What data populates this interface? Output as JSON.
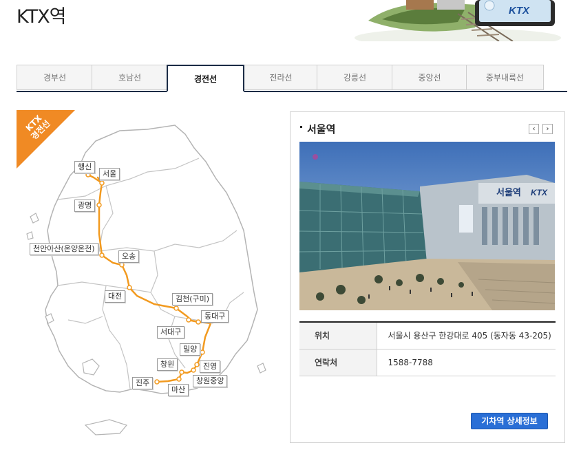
{
  "page": {
    "title": "KTX역"
  },
  "banner": {
    "logo_text": "KTX"
  },
  "tabs": [
    {
      "label": "경부선",
      "active": false
    },
    {
      "label": "호남선",
      "active": false
    },
    {
      "label": "경전선",
      "active": true
    },
    {
      "label": "전라선",
      "active": false
    },
    {
      "label": "강릉선",
      "active": false
    },
    {
      "label": "중앙선",
      "active": false
    },
    {
      "label": "중부내륙선",
      "active": false
    }
  ],
  "map": {
    "ribbon_line1": "KTX",
    "ribbon_line2": "경전선",
    "line_color": "#f29a1f",
    "ribbon_color": "#f08a24",
    "stations": [
      {
        "key": "haengsin",
        "name": "행신"
      },
      {
        "key": "seoul",
        "name": "서울"
      },
      {
        "key": "gwangmyeong",
        "name": "광명"
      },
      {
        "key": "cheonanasan",
        "name": "천안아산(온양온천)"
      },
      {
        "key": "osong",
        "name": "오송"
      },
      {
        "key": "daejeon",
        "name": "대전"
      },
      {
        "key": "gimcheon",
        "name": "김천(구미)"
      },
      {
        "key": "dongdaegu",
        "name": "동대구"
      },
      {
        "key": "seodaegu",
        "name": "서대구"
      },
      {
        "key": "miryang",
        "name": "밀양"
      },
      {
        "key": "jinyeong",
        "name": "진영"
      },
      {
        "key": "changwon",
        "name": "창원"
      },
      {
        "key": "changwonjungang",
        "name": "창원중앙"
      },
      {
        "key": "masan",
        "name": "마산"
      },
      {
        "key": "jinju",
        "name": "진주"
      }
    ]
  },
  "panel": {
    "station_title": "서울역",
    "prev_label": "‹",
    "next_label": "›",
    "photo_sign": "서울역",
    "rows": [
      {
        "label": "위치",
        "value": "서울시 용산구 한강대로 405 (동자동 43-205)"
      },
      {
        "label": "연락처",
        "value": "1588-7788"
      }
    ],
    "detail_button": "기차역 상세정보",
    "accent_color": "#2a6fd6"
  }
}
